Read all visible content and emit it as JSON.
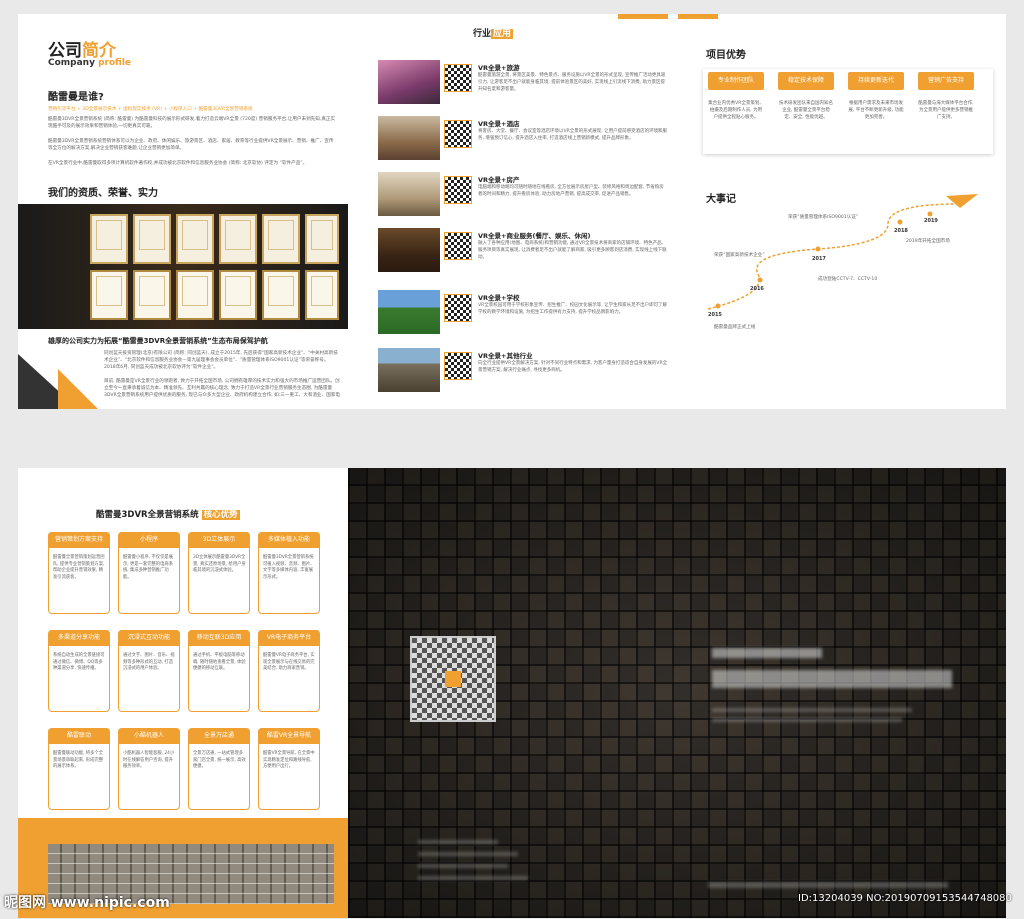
{
  "company": {
    "title_cn_a": "公司",
    "title_cn_b": "简介",
    "title_en_a": "Company",
    "title_en_b": "profile",
    "who_heading": "酷雷曼是谁?",
    "tagline": "营销引流平台 + 3D全景展示技术 + 虚拟现实技术 (VR) + 小程序入口 + 酷雷曼3DVR全景营销系统",
    "intro_1": "酷雷曼3DVR全景营销系统 (简称: 酷雷曼) 为酷雷曼科技的展示形式研发,着力打造云端VR全景 (720度) 营销服务平台,让用户未到先知,真正实现酷手可及的展示效果和营销体验,一切更真实可靠。",
    "intro_2": "酷雷曼3DVR全景营销系统营销体系可以为企业、政府、休闲娱乐、旅游景区、酒店、家居、教育等行业提供VR全景展示、营销、推广、宣传等全方位的解决方案,解决企业营销获客难题,让企业营销更加简单。",
    "intro_3": "在VR全景行业中,酷雷曼取得多项计算机软件著作权,并成功被北京软件和信息服务业协会 (简称: 北京软协) 评定为 “软件产品”。",
    "honor_heading": "我们的资质、荣誉、实力",
    "slogan": "雄厚的公司实力为拓展“酷雷曼3DVR全景营销系统”生态布局保驾护航",
    "body_1": "同创蓝天投资管理(北京)有限公司 (简称: 同创蓝天), 成立于2015年, 先后获得“国家高新技术企业”、“中关村高新技术企业”、“北京软件和信息服务业协会—第九届理事会会员单位”、“质量管理体系ISO9001认证”等荣誉称号。2018年6月, 同创蓝天成功被北京软协评为“软件企业”。",
    "body_2": "目前, 酷雷曼是VR全景行业的领跑者, 致力于开拓全国市场, 公司拥有雄厚的技术实力和强大的市场推广运营团队。创立至今一直秉承着诚信为本、精准领先、互利共赢的核心理念, 致力于打造VR全景行业营销服务生态圈, 为酷雷曼3DVR全景营销系统用户提供优质的服务, 现已与众多大型企业、政府机构建立合作, 如:三一重工、大和酒业、国家电网...",
    "body_3": "2018年,酷雷曼实力登陆CCTV-7、CCTV-10, 品牌全面升级, 同时, 香港著名影星梁家辉担任酷雷曼品牌形象代言人, 进一步提升品牌知名度及影响力。"
  },
  "industry": {
    "title_a": "行业",
    "title_b": "应用",
    "rows": [
      {
        "name": "VR全景+旅游",
        "desc": "酷雷曼旅游全景, 将景区美景、特色景点、服务设施以VR全景的形式呈现, 宣传推广活动更具吸引力, 让游客足不出户就能身临其境, 提前体验景区的美好, 实现线上引流线下消费, 助力景区提升知名度和游客量。"
      },
      {
        "name": "VR全景+酒店",
        "desc": "将客房、大堂、餐厅、会议室等酒店环境以VR全景的形式展现, 让用户提前感受酒店的环境和服务, 增强预订信心, 提升酒店入住率, 打造酒店线上营销新模式, 提升品牌形象。"
      },
      {
        "name": "VR全景+房产",
        "desc": "电脑端和移动端均可随时随地在线看房, 全方位展示房屋户型、装修风格和周边配套, 节省购房者的时间和精力, 提升看房体验, 助力房地产营销, 提高成交率, 促进产品销售。"
      },
      {
        "name": "VR全景+商业服务(餐厅、娱乐、休闲)",
        "desc": "融入了各种应用(地图、电商系统)和营销功能, 通过VR全景技术将商家的店铺环境、特色产品、服务项目等真实展现, 让消费者足不出户就能了解商家, 吸引更多顾客到店消费, 实现线上线下联动。"
      },
      {
        "name": "VR全景+学校",
        "desc": "VR全景校园可用于学校形象宣传、招生推广、校园文化展示等, 让学生和家长足不出户即可了解学校的教学环境和设施, 为招生工作提供有力支持, 提升学校品牌影响力。"
      },
      {
        "name": "VR全景+其他行业",
        "desc": "向全行业提供VR全景解决方案, 针对不同行业特点和需求, 为客户量身打造适合自身发展的VR全景营销方案, 解决行业痛点, 寻找更多商机。"
      }
    ]
  },
  "advantage": {
    "heading": "项目优势",
    "tags": [
      {
        "label": "专业制作团队",
        "desc": "集合业内优秀VR全景策划、拍摄及后期制作人员, 为用户提供全程贴心服务。"
      },
      {
        "label": "稳定技术保障",
        "desc": "技术研发团队来自国内知名企业, 酷雷曼全景平台稳定、安全, 性能优越。"
      },
      {
        "label": "持续更新迭代",
        "desc": "根据用户需求及未来市场发展, 平台不断更新升级, 功能更加完善。"
      },
      {
        "label": "营销广告支持",
        "desc": "酷雷曼与海大媒体平台合作, 为全景用户提供更多营销推广支持。"
      }
    ],
    "events_heading": "大事记",
    "years": [
      "2015",
      "2016",
      "2017",
      "2018",
      "2019"
    ],
    "event_notes": [
      "酷雷曼品牌正式上线",
      "荣获“国家高新技术企业”",
      "成功登陆CCTV-7、CCTV-10",
      "荣获“质量管理体系ISO9001认证”",
      "2019年开拓全国市场"
    ]
  },
  "core": {
    "title_a": "酷雷曼3DVR全景营销系统",
    "title_b": "核心优势",
    "boxes": [
      {
        "h": "营销策划方案支持",
        "t": "酷雷曼全景营销策划运营团队, 提供专业营销策划方案, 帮助企业提升营销效果, 精准引流获客。"
      },
      {
        "h": "小程序",
        "t": "酷雷曼小程序, 不仅仅是展示, 更是一套完整的电商系统, 集成多种营销推广功能。"
      },
      {
        "h": "3D立体展示",
        "t": "3D立体展示酷雷曼3DVR全景, 真实还原场景, 给用户身临其境的沉浸式体验。"
      },
      {
        "h": "多媒体植入功能",
        "t": "酷雷曼3DVR全景营销系统可植入视频、音频、图片、文字等多媒体内容, 丰富展示形式。"
      },
      {
        "h": "多渠道分享功能",
        "t": "系统自动生成的全景链接可通过微信、微博、QQ等多种渠道分享, 快速传播。"
      },
      {
        "h": "沉浸式互动功能",
        "t": "通过文字、图片、音乐、视频等多种形式的互动, 打造沉浸式的用户体验。"
      },
      {
        "h": "移动互联3D应用",
        "t": "通过手机、平板电脑等移动端, 随时随地查看全景, 体验便捷的移动互联。"
      },
      {
        "h": "VR电子商务平台",
        "t": "酷雷曼VR电子商务平台, 实现全景展示与在线交易的完美结合, 助力商家营销。"
      },
      {
        "h": "酷雷联动",
        "t": "酷雷曼联动功能, 将多个全景场景串联起来, 形成完整的展示体系。"
      },
      {
        "h": "小酷机器人",
        "t": "小酷机器人智能客服, 24小时在线解答用户咨询, 提升服务效率。"
      },
      {
        "h": "全景万店通",
        "t": "全景万店通, 一站式管理多家门店全景, 统一展示, 高效便捷。"
      },
      {
        "h": "酷雷VR全景导航",
        "t": "酷雷VR全景导航, 在全景中实现精准定位和路线导航, 方便用户出行。"
      }
    ]
  },
  "footer": {
    "watermark_left": "昵图网 www.nipic.com",
    "watermark_right": "ID:13204039 NO:20190709153544748080"
  },
  "colors": {
    "accent": "#f0a030",
    "dark": "#2b2b2b"
  }
}
